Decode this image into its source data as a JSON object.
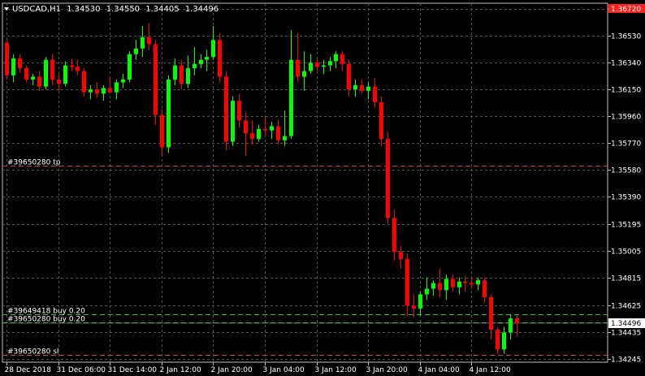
{
  "chart_data": {
    "type": "candlestick",
    "header": {
      "symbol": "USDCAD,H1",
      "open": "1.34530",
      "high": "1.34550",
      "low": "1.34405",
      "close": "1.34496"
    },
    "y_ticks": [
      "1.36720",
      "1.36530",
      "1.36340",
      "1.36150",
      "1.35960",
      "1.35770",
      "1.35580",
      "1.35390",
      "1.35195",
      "1.35005",
      "1.34815",
      "1.34625",
      "1.34435",
      "1.34245"
    ],
    "y_tick_values": [
      1.3672,
      1.3653,
      1.3634,
      1.3615,
      1.3596,
      1.3577,
      1.3558,
      1.3539,
      1.35195,
      1.35005,
      1.34815,
      1.34625,
      1.34435,
      1.34245
    ],
    "ylim": [
      1.3422,
      1.3676
    ],
    "x_ticks": [
      {
        "label": "28 Dec 2018",
        "index": 0
      },
      {
        "label": "31 Dec 06:00",
        "index": 8
      },
      {
        "label": "31 Dec 14:00",
        "index": 16
      },
      {
        "label": "2 Jan 12:00",
        "index": 24
      },
      {
        "label": "2 Jan 20:00",
        "index": 32
      },
      {
        "label": "3 Jan 04:00",
        "index": 40
      },
      {
        "label": "3 Jan 12:00",
        "index": 48
      },
      {
        "label": "3 Jan 20:00",
        "index": 56
      },
      {
        "label": "4 Jan 04:00",
        "index": 64
      },
      {
        "label": "4 Jan 12:00",
        "index": 72
      }
    ],
    "current_price": "1.34496",
    "current_price_value": 1.34496,
    "top_tag": "1.36720",
    "top_tag_value": 1.3672,
    "orders": [
      {
        "label": "#39650280 tp",
        "price": 1.3561,
        "color": "#d04040",
        "style": "dashed"
      },
      {
        "label": "#39649418 buy 0.20",
        "price": 1.3456,
        "color": "#30c030",
        "style": "dashed"
      },
      {
        "label": "#39650280 buy 0.20",
        "price": 1.345,
        "color": "#30c030",
        "style": "dashed"
      },
      {
        "label": "#39650280 sl",
        "price": 1.3427,
        "color": "#d04040",
        "style": "dashed"
      }
    ],
    "candles": [
      {
        "o": 1.3648,
        "h": 1.365,
        "l": 1.3622,
        "c": 1.3625
      },
      {
        "o": 1.3625,
        "h": 1.364,
        "l": 1.362,
        "c": 1.3637
      },
      {
        "o": 1.3637,
        "h": 1.364,
        "l": 1.3627,
        "c": 1.363
      },
      {
        "o": 1.363,
        "h": 1.3632,
        "l": 1.362,
        "c": 1.3622
      },
      {
        "o": 1.3622,
        "h": 1.3626,
        "l": 1.3618,
        "c": 1.3624
      },
      {
        "o": 1.3624,
        "h": 1.3628,
        "l": 1.3614,
        "c": 1.3617
      },
      {
        "o": 1.3617,
        "h": 1.3638,
        "l": 1.3615,
        "c": 1.3636
      },
      {
        "o": 1.3636,
        "h": 1.364,
        "l": 1.3618,
        "c": 1.3622
      },
      {
        "o": 1.3622,
        "h": 1.3626,
        "l": 1.3614,
        "c": 1.3619
      },
      {
        "o": 1.3619,
        "h": 1.3635,
        "l": 1.3617,
        "c": 1.3632
      },
      {
        "o": 1.3632,
        "h": 1.3637,
        "l": 1.3628,
        "c": 1.3631
      },
      {
        "o": 1.3631,
        "h": 1.3636,
        "l": 1.3625,
        "c": 1.3628
      },
      {
        "o": 1.3628,
        "h": 1.363,
        "l": 1.361,
        "c": 1.3613
      },
      {
        "o": 1.3613,
        "h": 1.3618,
        "l": 1.3608,
        "c": 1.3615
      },
      {
        "o": 1.3615,
        "h": 1.362,
        "l": 1.3609,
        "c": 1.3612
      },
      {
        "o": 1.3612,
        "h": 1.3618,
        "l": 1.3607,
        "c": 1.3616
      },
      {
        "o": 1.3616,
        "h": 1.3624,
        "l": 1.3612,
        "c": 1.3613
      },
      {
        "o": 1.3613,
        "h": 1.3622,
        "l": 1.3608,
        "c": 1.362
      },
      {
        "o": 1.362,
        "h": 1.3626,
        "l": 1.3616,
        "c": 1.3622
      },
      {
        "o": 1.3622,
        "h": 1.3642,
        "l": 1.362,
        "c": 1.364
      },
      {
        "o": 1.364,
        "h": 1.365,
        "l": 1.3636,
        "c": 1.3644
      },
      {
        "o": 1.3644,
        "h": 1.366,
        "l": 1.3638,
        "c": 1.3652
      },
      {
        "o": 1.3652,
        "h": 1.3662,
        "l": 1.3643,
        "c": 1.3647
      },
      {
        "o": 1.3647,
        "h": 1.365,
        "l": 1.359,
        "c": 1.3597
      },
      {
        "o": 1.3597,
        "h": 1.3601,
        "l": 1.3568,
        "c": 1.3574
      },
      {
        "o": 1.3574,
        "h": 1.3625,
        "l": 1.357,
        "c": 1.3622
      },
      {
        "o": 1.3622,
        "h": 1.3637,
        "l": 1.3618,
        "c": 1.3632
      },
      {
        "o": 1.3632,
        "h": 1.3636,
        "l": 1.3615,
        "c": 1.3619
      },
      {
        "o": 1.3619,
        "h": 1.3639,
        "l": 1.3616,
        "c": 1.363
      },
      {
        "o": 1.363,
        "h": 1.3645,
        "l": 1.3625,
        "c": 1.3633
      },
      {
        "o": 1.3633,
        "h": 1.364,
        "l": 1.363,
        "c": 1.3636
      },
      {
        "o": 1.3636,
        "h": 1.3643,
        "l": 1.3628,
        "c": 1.3638
      },
      {
        "o": 1.3638,
        "h": 1.366,
        "l": 1.3636,
        "c": 1.365
      },
      {
        "o": 1.365,
        "h": 1.3655,
        "l": 1.362,
        "c": 1.3624
      },
      {
        "o": 1.3624,
        "h": 1.3628,
        "l": 1.3572,
        "c": 1.3578
      },
      {
        "o": 1.3578,
        "h": 1.361,
        "l": 1.3575,
        "c": 1.3607
      },
      {
        "o": 1.3607,
        "h": 1.3612,
        "l": 1.3588,
        "c": 1.3593
      },
      {
        "o": 1.3593,
        "h": 1.3599,
        "l": 1.3568,
        "c": 1.3584
      },
      {
        "o": 1.3584,
        "h": 1.3593,
        "l": 1.3576,
        "c": 1.358
      },
      {
        "o": 1.358,
        "h": 1.359,
        "l": 1.3578,
        "c": 1.3587
      },
      {
        "o": 1.3587,
        "h": 1.3596,
        "l": 1.3582,
        "c": 1.3586
      },
      {
        "o": 1.3586,
        "h": 1.3592,
        "l": 1.358,
        "c": 1.3589
      },
      {
        "o": 1.3589,
        "h": 1.3594,
        "l": 1.3576,
        "c": 1.3579
      },
      {
        "o": 1.3579,
        "h": 1.36,
        "l": 1.3575,
        "c": 1.3582
      },
      {
        "o": 1.3582,
        "h": 1.3657,
        "l": 1.358,
        "c": 1.3636
      },
      {
        "o": 1.3636,
        "h": 1.3655,
        "l": 1.362,
        "c": 1.3624
      },
      {
        "o": 1.3624,
        "h": 1.3642,
        "l": 1.3614,
        "c": 1.3628
      },
      {
        "o": 1.3628,
        "h": 1.364,
        "l": 1.3626,
        "c": 1.3634
      },
      {
        "o": 1.3634,
        "h": 1.3637,
        "l": 1.3628,
        "c": 1.3631
      },
      {
        "o": 1.3631,
        "h": 1.3636,
        "l": 1.3626,
        "c": 1.3632
      },
      {
        "o": 1.3632,
        "h": 1.3638,
        "l": 1.3628,
        "c": 1.3635
      },
      {
        "o": 1.3635,
        "h": 1.3642,
        "l": 1.363,
        "c": 1.364
      },
      {
        "o": 1.364,
        "h": 1.3642,
        "l": 1.3628,
        "c": 1.3633
      },
      {
        "o": 1.3633,
        "h": 1.3636,
        "l": 1.361,
        "c": 1.3615
      },
      {
        "o": 1.3615,
        "h": 1.3622,
        "l": 1.361,
        "c": 1.3618
      },
      {
        "o": 1.3618,
        "h": 1.3622,
        "l": 1.3612,
        "c": 1.3614
      },
      {
        "o": 1.3614,
        "h": 1.362,
        "l": 1.3608,
        "c": 1.3617
      },
      {
        "o": 1.3617,
        "h": 1.3623,
        "l": 1.3602,
        "c": 1.3606
      },
      {
        "o": 1.3606,
        "h": 1.361,
        "l": 1.3575,
        "c": 1.358
      },
      {
        "o": 1.358,
        "h": 1.3585,
        "l": 1.352,
        "c": 1.3524
      },
      {
        "o": 1.3524,
        "h": 1.353,
        "l": 1.3494,
        "c": 1.35
      },
      {
        "o": 1.35,
        "h": 1.3504,
        "l": 1.3488,
        "c": 1.3495
      },
      {
        "o": 1.3495,
        "h": 1.3499,
        "l": 1.3455,
        "c": 1.3462
      },
      {
        "o": 1.3462,
        "h": 1.347,
        "l": 1.3454,
        "c": 1.346
      },
      {
        "o": 1.346,
        "h": 1.3472,
        "l": 1.3455,
        "c": 1.347
      },
      {
        "o": 1.347,
        "h": 1.3482,
        "l": 1.3466,
        "c": 1.3474
      },
      {
        "o": 1.3474,
        "h": 1.348,
        "l": 1.3469,
        "c": 1.3478
      },
      {
        "o": 1.3478,
        "h": 1.3488,
        "l": 1.3468,
        "c": 1.3473
      },
      {
        "o": 1.3473,
        "h": 1.3484,
        "l": 1.3466,
        "c": 1.3481
      },
      {
        "o": 1.3481,
        "h": 1.3484,
        "l": 1.3472,
        "c": 1.3475
      },
      {
        "o": 1.3475,
        "h": 1.3482,
        "l": 1.347,
        "c": 1.3479
      },
      {
        "o": 1.3479,
        "h": 1.3483,
        "l": 1.3472,
        "c": 1.3478
      },
      {
        "o": 1.3478,
        "h": 1.3482,
        "l": 1.3474,
        "c": 1.3477
      },
      {
        "o": 1.3477,
        "h": 1.3482,
        "l": 1.3473,
        "c": 1.348
      },
      {
        "o": 1.348,
        "h": 1.3482,
        "l": 1.3464,
        "c": 1.3468
      },
      {
        "o": 1.3468,
        "h": 1.347,
        "l": 1.3438,
        "c": 1.3445
      },
      {
        "o": 1.3445,
        "h": 1.3447,
        "l": 1.3428,
        "c": 1.3431
      },
      {
        "o": 1.3431,
        "h": 1.3447,
        "l": 1.3428,
        "c": 1.3443
      },
      {
        "o": 1.3443,
        "h": 1.3456,
        "l": 1.3438,
        "c": 1.3453
      },
      {
        "o": 1.3453,
        "h": 1.3455,
        "l": 1.34405,
        "c": 1.34496
      }
    ],
    "colors": {
      "background": "#000000",
      "grid": "#505050",
      "axis": "#c0c0c0",
      "bull": "#00ff00",
      "bear": "#ff0000",
      "wick_bull": "#00ff00",
      "wick_bear": "#ff0000",
      "text": "#ffffff",
      "top_tag_bg": "#ff2020",
      "price_tag_bg": "#ffffff",
      "price_tag_fg": "#000000"
    }
  }
}
